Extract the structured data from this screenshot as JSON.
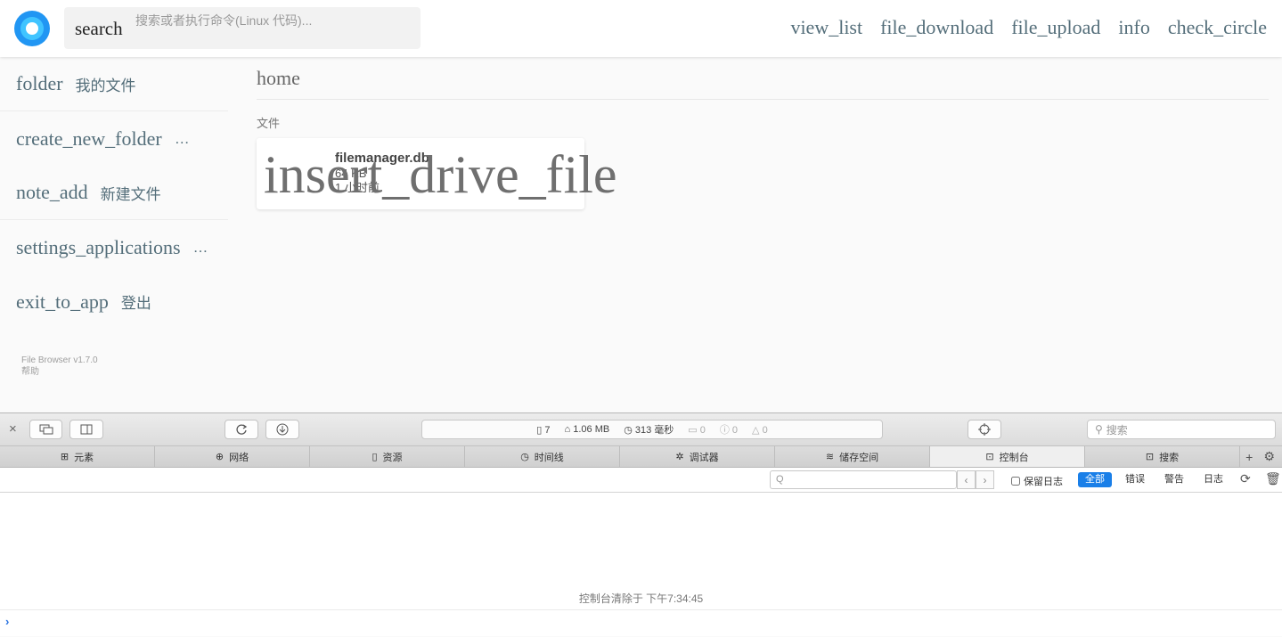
{
  "header": {
    "search_icon_label": "search",
    "search_placeholder": "搜索或者执行命令(Linux 代码)...",
    "actions": [
      "view_list",
      "file_download",
      "file_upload",
      "info",
      "check_circle"
    ]
  },
  "sidebar": {
    "items": [
      {
        "icon": "folder",
        "label": "我的文件"
      },
      {
        "icon": "create_new_folder",
        "label": "…"
      },
      {
        "icon": "note_add",
        "label": "新建文件"
      },
      {
        "icon": "settings_applications",
        "label": "…"
      },
      {
        "icon": "exit_to_app",
        "label": "登出"
      }
    ],
    "version": "File Browser v1.7.0",
    "help": "帮助"
  },
  "main": {
    "breadcrumb": "home",
    "section_title": "文件",
    "file": {
      "icon": "insert_drive_file",
      "name": "filemanager.db",
      "size": "64 KB",
      "date": "1 小时前"
    }
  },
  "devtools": {
    "close": "×",
    "status": {
      "resources": "7",
      "size": "1.06 MB",
      "time": "313 毫秒",
      "logs": "0",
      "errors": "0",
      "warnings": "0"
    },
    "search_placeholder": "搜索",
    "tabs": [
      "元素",
      "网络",
      "资源",
      "时间线",
      "调试器",
      "储存空间",
      "控制台",
      "搜索"
    ],
    "active_tab": "控制台",
    "filter_placeholder": "Q",
    "preserve_log": "保留日志",
    "levels": [
      "全部",
      "错误",
      "警告",
      "日志"
    ],
    "console_message": "控制台清除于 下午7:34:45",
    "prompt": "›"
  }
}
